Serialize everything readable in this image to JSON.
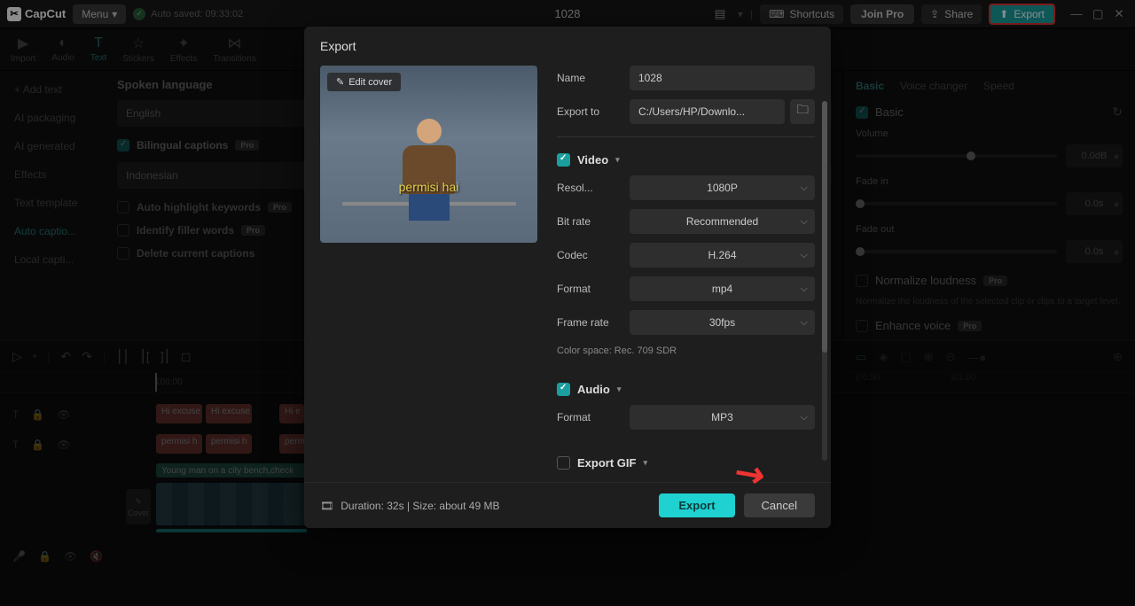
{
  "app": {
    "name": "CapCut",
    "menu": "Menu",
    "autosave": "Auto saved: 09:33:02",
    "title": "1028"
  },
  "topbar": {
    "shortcuts": "Shortcuts",
    "joinpro": "Join Pro",
    "share": "Share",
    "export": "Export"
  },
  "tabs": {
    "import": "Import",
    "audio": "Audio",
    "text": "Text",
    "stickers": "Stickers",
    "effects": "Effects",
    "transitions": "Transitions"
  },
  "sidebar": {
    "add_text": "Add text",
    "ai_packaging": "AI packaging",
    "ai_generated": "AI generated",
    "effects": "Effects",
    "text_template": "Text template",
    "auto_captions": "Auto captio...",
    "local_captions": "Local capti..."
  },
  "middle": {
    "spoken_language": "Spoken language",
    "english": "English",
    "bilingual_captions": "Bilingual captions",
    "indonesian": "Indonesian",
    "auto_highlight": "Auto highlight keywords",
    "identify_filler": "Identify filler words",
    "delete_captions": "Delete current captions",
    "pro": "Pro"
  },
  "inspector": {
    "tabs": {
      "basic": "Basic",
      "voice_changer": "Voice changer",
      "speed": "Speed"
    },
    "basic": "Basic",
    "volume": "Volume",
    "volume_val": "0.0dB",
    "fade_in": "Fade in",
    "fade_in_val": "0.0s",
    "fade_out": "Fade out",
    "fade_out_val": "0.0s",
    "normalize": "Normalize loudness",
    "pro": "Pro",
    "normalize_desc": "Normalize the loudness of the selected clip or clips to a target level.",
    "enhance": "Enhance voice",
    "tick1": "|00:50",
    "tick2": "|01:00"
  },
  "timeline": {
    "ruler_0": "100:00",
    "clip_hi1": "Hi excuse",
    "clip_hi2": "Hi excuse",
    "clip_hi3": "Hi e",
    "clip_p1": "permisi h",
    "clip_p2": "permisi h",
    "clip_p3": "perm",
    "videoclip": "Young man on a city bench,check",
    "cover": "Cover"
  },
  "modal": {
    "title": "Export",
    "edit_cover": "Edit cover",
    "caption": "permisi hai",
    "name_label": "Name",
    "name_val": "1028",
    "export_to_label": "Export to",
    "export_to_val": "C:/Users/HP/Downlo...",
    "video": "Video",
    "resolution_label": "Resol...",
    "resolution_val": "1080P",
    "bitrate_label": "Bit rate",
    "bitrate_val": "Recommended",
    "codec_label": "Codec",
    "codec_val": "H.264",
    "format_label": "Format",
    "format_val": "mp4",
    "framerate_label": "Frame rate",
    "framerate_val": "30fps",
    "colorspace": "Color space: Rec. 709 SDR",
    "audio": "Audio",
    "audio_format_label": "Format",
    "audio_format_val": "MP3",
    "export_gif": "Export GIF",
    "duration": "Duration: 32s | Size: about 49 MB",
    "export_btn": "Export",
    "cancel_btn": "Cancel"
  }
}
